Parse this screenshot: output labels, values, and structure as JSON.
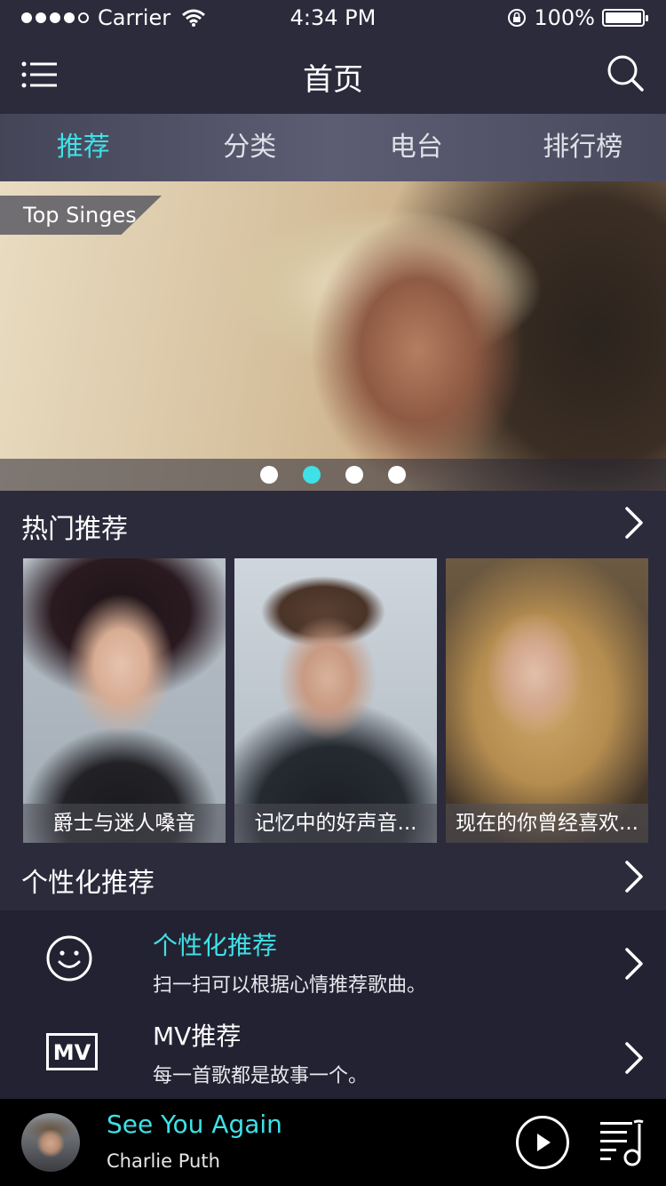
{
  "status_bar": {
    "carrier": "Carrier",
    "time": "4:34 PM",
    "battery": "100%"
  },
  "nav": {
    "title": "首页"
  },
  "tabs": [
    {
      "label": "推荐",
      "active": true
    },
    {
      "label": "分类",
      "active": false
    },
    {
      "label": "电台",
      "active": false
    },
    {
      "label": "排行榜",
      "active": false
    }
  ],
  "banner": {
    "tag": "Top Singes",
    "page_count": 4,
    "active_page": 2
  },
  "hot": {
    "title": "热门推荐",
    "items": [
      {
        "caption": "爵士与迷人嗓音"
      },
      {
        "caption": "记忆中的好声音..."
      },
      {
        "caption": "现在的你曾经喜欢..."
      }
    ]
  },
  "personal": {
    "title": "个性化推荐",
    "rows": [
      {
        "title": "个性化推荐",
        "desc": "扫一扫可以根据心情推荐歌曲。",
        "icon": "smiley-icon"
      },
      {
        "title": "MV推荐",
        "desc": "每一首歌都是故事一个。",
        "icon": "mv-icon",
        "icon_text": "MV"
      }
    ]
  },
  "player": {
    "song": "See You Again",
    "artist": "Charlie Puth"
  },
  "colors": {
    "accent": "#3ee1e6",
    "background": "#2c2b3c",
    "panel": "#232232",
    "player": "#000000"
  }
}
